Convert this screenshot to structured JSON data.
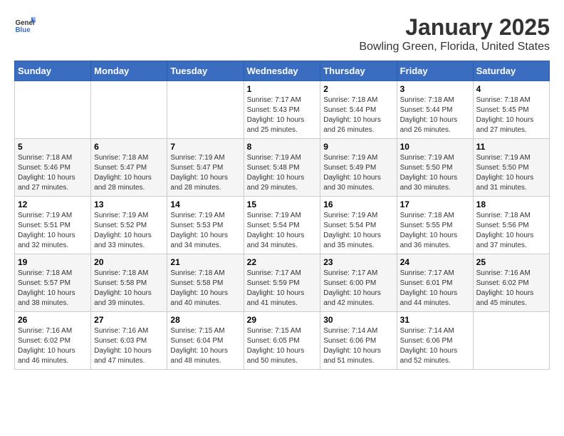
{
  "header": {
    "logo_general": "General",
    "logo_blue": "Blue",
    "month_year": "January 2025",
    "location": "Bowling Green, Florida, United States"
  },
  "weekdays": [
    "Sunday",
    "Monday",
    "Tuesday",
    "Wednesday",
    "Thursday",
    "Friday",
    "Saturday"
  ],
  "weeks": [
    [
      {
        "day": "",
        "info": ""
      },
      {
        "day": "",
        "info": ""
      },
      {
        "day": "",
        "info": ""
      },
      {
        "day": "1",
        "info": "Sunrise: 7:17 AM\nSunset: 5:43 PM\nDaylight: 10 hours\nand 25 minutes."
      },
      {
        "day": "2",
        "info": "Sunrise: 7:18 AM\nSunset: 5:44 PM\nDaylight: 10 hours\nand 26 minutes."
      },
      {
        "day": "3",
        "info": "Sunrise: 7:18 AM\nSunset: 5:44 PM\nDaylight: 10 hours\nand 26 minutes."
      },
      {
        "day": "4",
        "info": "Sunrise: 7:18 AM\nSunset: 5:45 PM\nDaylight: 10 hours\nand 27 minutes."
      }
    ],
    [
      {
        "day": "5",
        "info": "Sunrise: 7:18 AM\nSunset: 5:46 PM\nDaylight: 10 hours\nand 27 minutes."
      },
      {
        "day": "6",
        "info": "Sunrise: 7:18 AM\nSunset: 5:47 PM\nDaylight: 10 hours\nand 28 minutes."
      },
      {
        "day": "7",
        "info": "Sunrise: 7:19 AM\nSunset: 5:47 PM\nDaylight: 10 hours\nand 28 minutes."
      },
      {
        "day": "8",
        "info": "Sunrise: 7:19 AM\nSunset: 5:48 PM\nDaylight: 10 hours\nand 29 minutes."
      },
      {
        "day": "9",
        "info": "Sunrise: 7:19 AM\nSunset: 5:49 PM\nDaylight: 10 hours\nand 30 minutes."
      },
      {
        "day": "10",
        "info": "Sunrise: 7:19 AM\nSunset: 5:50 PM\nDaylight: 10 hours\nand 30 minutes."
      },
      {
        "day": "11",
        "info": "Sunrise: 7:19 AM\nSunset: 5:50 PM\nDaylight: 10 hours\nand 31 minutes."
      }
    ],
    [
      {
        "day": "12",
        "info": "Sunrise: 7:19 AM\nSunset: 5:51 PM\nDaylight: 10 hours\nand 32 minutes."
      },
      {
        "day": "13",
        "info": "Sunrise: 7:19 AM\nSunset: 5:52 PM\nDaylight: 10 hours\nand 33 minutes."
      },
      {
        "day": "14",
        "info": "Sunrise: 7:19 AM\nSunset: 5:53 PM\nDaylight: 10 hours\nand 34 minutes."
      },
      {
        "day": "15",
        "info": "Sunrise: 7:19 AM\nSunset: 5:54 PM\nDaylight: 10 hours\nand 34 minutes."
      },
      {
        "day": "16",
        "info": "Sunrise: 7:19 AM\nSunset: 5:54 PM\nDaylight: 10 hours\nand 35 minutes."
      },
      {
        "day": "17",
        "info": "Sunrise: 7:18 AM\nSunset: 5:55 PM\nDaylight: 10 hours\nand 36 minutes."
      },
      {
        "day": "18",
        "info": "Sunrise: 7:18 AM\nSunset: 5:56 PM\nDaylight: 10 hours\nand 37 minutes."
      }
    ],
    [
      {
        "day": "19",
        "info": "Sunrise: 7:18 AM\nSunset: 5:57 PM\nDaylight: 10 hours\nand 38 minutes."
      },
      {
        "day": "20",
        "info": "Sunrise: 7:18 AM\nSunset: 5:58 PM\nDaylight: 10 hours\nand 39 minutes."
      },
      {
        "day": "21",
        "info": "Sunrise: 7:18 AM\nSunset: 5:58 PM\nDaylight: 10 hours\nand 40 minutes."
      },
      {
        "day": "22",
        "info": "Sunrise: 7:17 AM\nSunset: 5:59 PM\nDaylight: 10 hours\nand 41 minutes."
      },
      {
        "day": "23",
        "info": "Sunrise: 7:17 AM\nSunset: 6:00 PM\nDaylight: 10 hours\nand 42 minutes."
      },
      {
        "day": "24",
        "info": "Sunrise: 7:17 AM\nSunset: 6:01 PM\nDaylight: 10 hours\nand 44 minutes."
      },
      {
        "day": "25",
        "info": "Sunrise: 7:16 AM\nSunset: 6:02 PM\nDaylight: 10 hours\nand 45 minutes."
      }
    ],
    [
      {
        "day": "26",
        "info": "Sunrise: 7:16 AM\nSunset: 6:02 PM\nDaylight: 10 hours\nand 46 minutes."
      },
      {
        "day": "27",
        "info": "Sunrise: 7:16 AM\nSunset: 6:03 PM\nDaylight: 10 hours\nand 47 minutes."
      },
      {
        "day": "28",
        "info": "Sunrise: 7:15 AM\nSunset: 6:04 PM\nDaylight: 10 hours\nand 48 minutes."
      },
      {
        "day": "29",
        "info": "Sunrise: 7:15 AM\nSunset: 6:05 PM\nDaylight: 10 hours\nand 50 minutes."
      },
      {
        "day": "30",
        "info": "Sunrise: 7:14 AM\nSunset: 6:06 PM\nDaylight: 10 hours\nand 51 minutes."
      },
      {
        "day": "31",
        "info": "Sunrise: 7:14 AM\nSunset: 6:06 PM\nDaylight: 10 hours\nand 52 minutes."
      },
      {
        "day": "",
        "info": ""
      }
    ]
  ]
}
